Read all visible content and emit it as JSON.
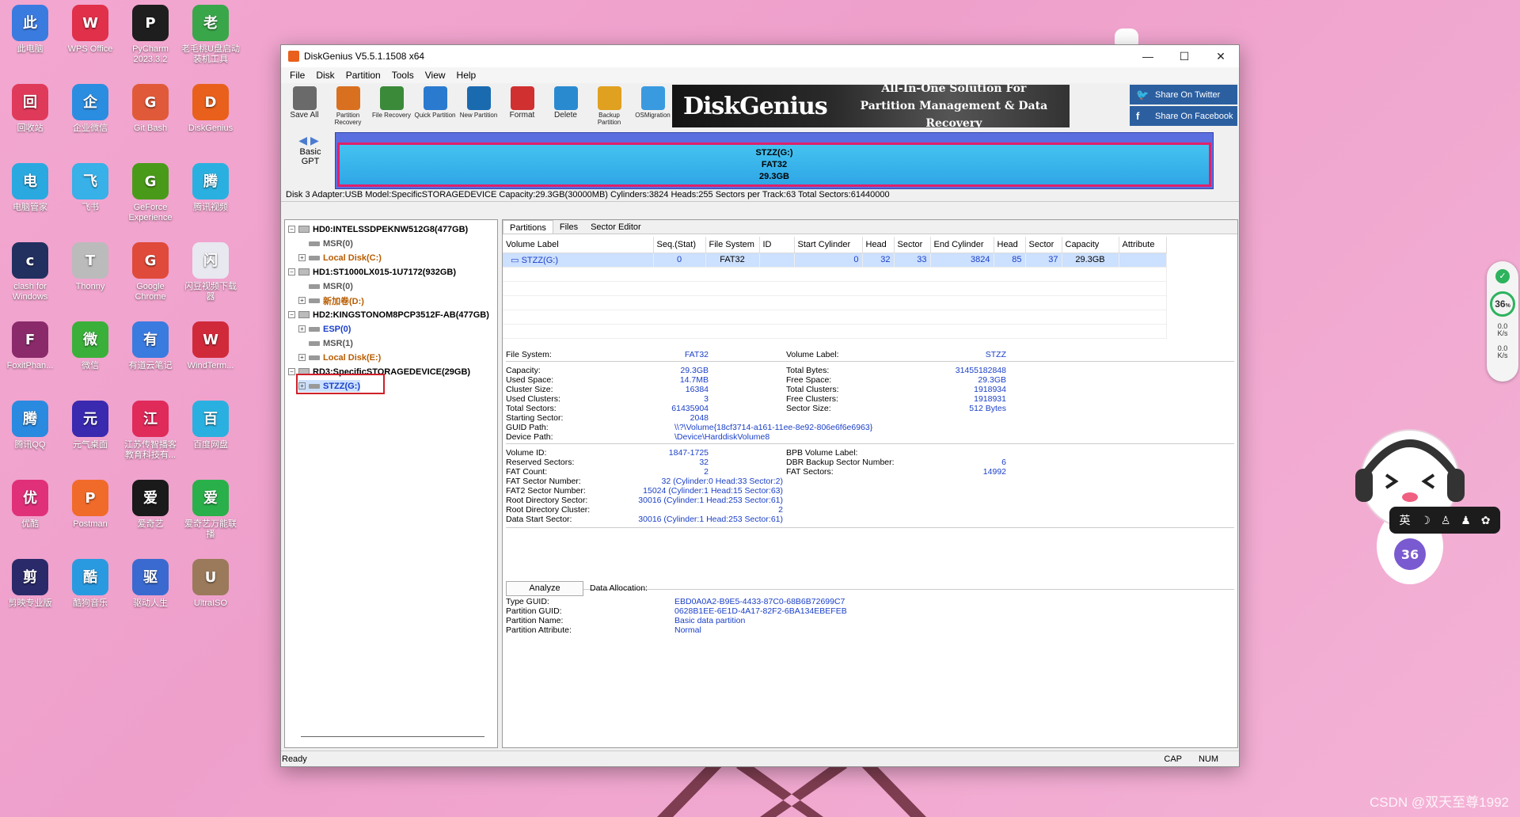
{
  "desktop": {
    "icons": [
      {
        "label": "此电脑",
        "color": "#3a7be0"
      },
      {
        "label": "WPS Office",
        "color": "#e0304a"
      },
      {
        "label": "PyCharm 2023.3.2",
        "color": "#1e1e1e"
      },
      {
        "label": "老毛桃U盘启动装机工具",
        "color": "#3aa64a"
      },
      {
        "label": "回收站",
        "color": "#e03a5a"
      },
      {
        "label": "企业微信",
        "color": "#2b8de0"
      },
      {
        "label": "Git Bash",
        "color": "#e05a3a"
      },
      {
        "label": "DiskGenius",
        "color": "#e8601c"
      },
      {
        "label": "电脑管家",
        "color": "#2aa8e0"
      },
      {
        "label": "飞书",
        "color": "#38b0e8"
      },
      {
        "label": "GeForce Experience",
        "color": "#4a9a1a"
      },
      {
        "label": "腾讯视频",
        "color": "#2ab0e0"
      },
      {
        "label": "clash for Windows",
        "color": "#223060"
      },
      {
        "label": "Thonny",
        "color": "#bbbbbb"
      },
      {
        "label": "Google Chrome",
        "color": "#e04a3a"
      },
      {
        "label": "闪豆视频下载器",
        "color": "#e8e8f0"
      },
      {
        "label": "FoxitPhan...",
        "color": "#8a2a6a"
      },
      {
        "label": "微信",
        "color": "#3ab03a"
      },
      {
        "label": "有道云笔记",
        "color": "#3a7be0"
      },
      {
        "label": "WindTerm...",
        "color": "#d02a3a"
      },
      {
        "label": "腾讯QQ",
        "color": "#2a8ae0"
      },
      {
        "label": "元气桌面",
        "color": "#3a2ab0"
      },
      {
        "label": "江苏传智播客教育科技有...",
        "color": "#e02a5a"
      },
      {
        "label": "百度网盘",
        "color": "#2ab0e0"
      },
      {
        "label": "优酷",
        "color": "#e0307a"
      },
      {
        "label": "Postman",
        "color": "#f06a2a"
      },
      {
        "label": "爱奇艺",
        "color": "#1a1a1a"
      },
      {
        "label": "爱奇艺万能联播",
        "color": "#2ab04a"
      },
      {
        "label": "剪映专业版",
        "color": "#2a2a6a"
      },
      {
        "label": "酷狗音乐",
        "color": "#2a9ae0"
      },
      {
        "label": "驱动人生",
        "color": "#3a6ad0"
      },
      {
        "label": "UltraISO",
        "color": "#9a7a5a"
      }
    ],
    "watermark": "CSDN @双天至尊1992",
    "net_widget": {
      "percent": "36",
      "percent_unit": "%",
      "up": "0.0",
      "up_unit": "K/s",
      "down": "0.0",
      "down_unit": "K/s"
    },
    "mascot_badge": "36",
    "ime": {
      "lang": "英",
      "moon": "☽",
      "person": "♙",
      "shirt": "♟",
      "gear": "✿"
    }
  },
  "window": {
    "title": "DiskGenius V5.5.1.1508 x64",
    "menu": [
      "File",
      "Disk",
      "Partition",
      "Tools",
      "View",
      "Help"
    ],
    "toolbar": [
      {
        "label": "Save All",
        "icon": "save-all-icon",
        "color": "#6a6a6a",
        "small": false
      },
      {
        "label": "Partition Recovery",
        "icon": "partition-recovery-icon",
        "color": "#d87020",
        "small": true
      },
      {
        "label": "File Recovery",
        "icon": "file-recovery-icon",
        "color": "#3a8a3a",
        "small": true
      },
      {
        "label": "Quick Partition",
        "icon": "quick-partition-icon",
        "color": "#2a7ad0",
        "small": true
      },
      {
        "label": "New Partition",
        "icon": "new-partition-icon",
        "color": "#1a6ab0",
        "small": true
      },
      {
        "label": "Format",
        "icon": "format-icon",
        "color": "#d03030",
        "small": false
      },
      {
        "label": "Delete",
        "icon": "delete-icon",
        "color": "#2a8ad0",
        "small": false
      },
      {
        "label": "Backup Partition",
        "icon": "backup-partition-icon",
        "color": "#e0a020",
        "small": true
      },
      {
        "label": "OSMigration",
        "icon": "os-migration-icon",
        "color": "#3a9ae0",
        "small": true
      }
    ],
    "banner": {
      "logo": "DiskGenius",
      "tag1": "All-In-One Solution For",
      "tag2": "Partition Management & Data Recovery"
    },
    "share": {
      "twitter": "Share On Twitter",
      "facebook": "Share On Facebook"
    },
    "disk_nav": {
      "type1": "Basic",
      "type2": "GPT"
    },
    "partition_bar": {
      "name": "STZZ(G:)",
      "fs": "FAT32",
      "size": "29.3GB"
    },
    "disk_info": "Disk 3 Adapter:USB  Model:SpecificSTORAGEDEVICE  Capacity:29.3GB(30000MB)  Cylinders:3824  Heads:255  Sectors per Track:63  Total Sectors:61440000",
    "tree": [
      {
        "text": "HD0:INTELSSDPEKNW512G8(477GB)",
        "kind": "disk"
      },
      {
        "text": "MSR(0)",
        "kind": "gray"
      },
      {
        "text": "Local Disk(C:)",
        "kind": "brown"
      },
      {
        "text": "HD1:ST1000LX015-1U7172(932GB)",
        "kind": "disk"
      },
      {
        "text": "MSR(0)",
        "kind": "gray"
      },
      {
        "text": "新加卷(D:)",
        "kind": "brown"
      },
      {
        "text": "HD2:KINGSTONOM8PCP3512F-AB(477GB)",
        "kind": "disk"
      },
      {
        "text": "ESP(0)",
        "kind": "blue"
      },
      {
        "text": "MSR(1)",
        "kind": "gray"
      },
      {
        "text": "Local Disk(E:)",
        "kind": "brown"
      },
      {
        "text": "RD3:SpecificSTORAGEDEVICE(29GB)",
        "kind": "disk"
      },
      {
        "text": "STZZ(G:)",
        "kind": "blue"
      }
    ],
    "tabs": [
      "Partitions",
      "Files",
      "Sector Editor"
    ],
    "table": {
      "headers": [
        "Volume Label",
        "Seq.(Stat)",
        "File System",
        "ID",
        "Start Cylinder",
        "Head",
        "Sector",
        "End Cylinder",
        "Head",
        "Sector",
        "Capacity",
        "Attribute"
      ],
      "row": [
        "STZZ(G:)",
        "0",
        "FAT32",
        "",
        "0",
        "32",
        "33",
        "3824",
        "85",
        "37",
        "29.3GB",
        ""
      ]
    },
    "props": {
      "fs_label": "File System:",
      "fs": "FAT32",
      "vol_label": "Volume Label:",
      "vol": "STZZ",
      "capacity_l": "Capacity:",
      "capacity": "29.3GB",
      "total_bytes_l": "Total Bytes:",
      "total_bytes": "31455182848",
      "used_l": "Used Space:",
      "used": "14.7MB",
      "free_l": "Free Space:",
      "free": "29.3GB",
      "cluster_l": "Cluster Size:",
      "cluster": "16384",
      "total_clusters_l": "Total Clusters:",
      "total_clusters": "1918934",
      "used_clusters_l": "Used Clusters:",
      "used_clusters": "3",
      "free_clusters_l": "Free Clusters:",
      "free_clusters": "1918931",
      "total_sectors_l": "Total Sectors:",
      "total_sectors": "61435904",
      "sector_size_l": "Sector Size:",
      "sector_size": "512 Bytes",
      "start_sector_l": "Starting Sector:",
      "start_sector": "2048",
      "guid_path_l": "GUID Path:",
      "guid_path": "\\\\?\\Volume{18cf3714-a161-11ee-8e92-806e6f6e6963}",
      "device_path_l": "Device Path:",
      "device_path": "\\Device\\HarddiskVolume8",
      "volume_id_l": "Volume ID:",
      "volume_id": "1847-1725",
      "bpb_l": "BPB Volume Label:",
      "bpb": "",
      "reserved_l": "Reserved Sectors:",
      "reserved": "32",
      "dbr_l": "DBR Backup Sector Number:",
      "dbr": "6",
      "fat_count_l": "FAT Count:",
      "fat_count": "2",
      "fat_sectors_l": "FAT Sectors:",
      "fat_sectors": "14992",
      "fat_sector_num_l": "FAT Sector Number:",
      "fat_sector_num": "32 (Cylinder:0 Head:33 Sector:2)",
      "fat2_l": "FAT2 Sector Number:",
      "fat2": "15024 (Cylinder:1 Head:15 Sector:63)",
      "root_dir_l": "Root Directory Sector:",
      "root_dir": "30016 (Cylinder:1 Head:253 Sector:61)",
      "root_cluster_l": "Root Directory Cluster:",
      "root_cluster": "2",
      "data_start_l": "Data Start Sector:",
      "data_start": "30016 (Cylinder:1 Head:253 Sector:61)",
      "analyze": "Analyze",
      "data_alloc": "Data Allocation:",
      "type_guid_l": "Type GUID:",
      "type_guid": "EBD0A0A2-B9E5-4433-87C0-68B6B72699C7",
      "part_guid_l": "Partition GUID:",
      "part_guid": "0628B1EE-6E1D-4A17-82F2-6BA134EBEFEB",
      "part_name_l": "Partition Name:",
      "part_name": "Basic data partition",
      "part_attr_l": "Partition Attribute:",
      "part_attr": "Normal"
    },
    "status": {
      "text": "Ready",
      "cap": "CAP",
      "num": "NUM"
    }
  }
}
